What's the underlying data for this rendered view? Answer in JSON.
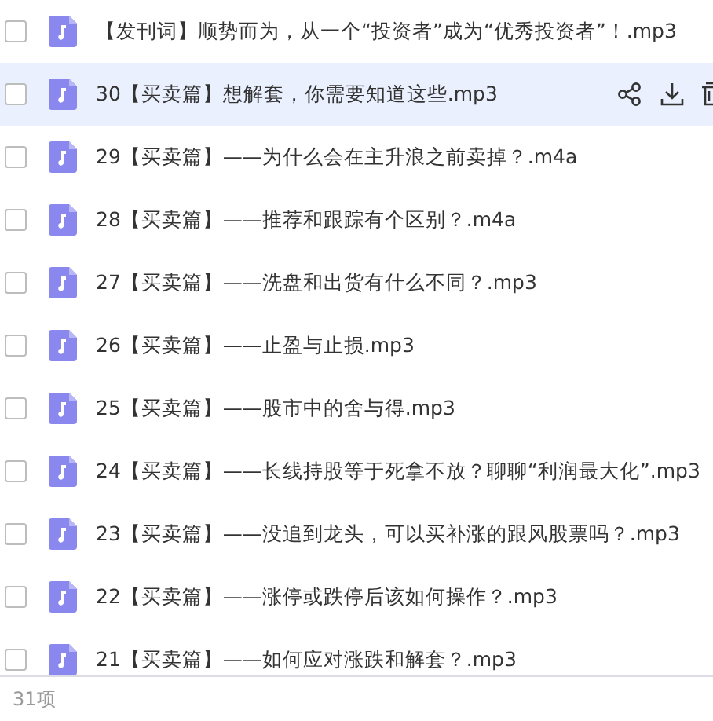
{
  "files": [
    {
      "name": "【发刊词】顺势而为，从一个“投资者”成为“优秀投资者”！.mp3",
      "checked": false,
      "highlighted": false
    },
    {
      "name": "30【买卖篇】想解套，你需要知道这些.mp3",
      "checked": false,
      "highlighted": true
    },
    {
      "name": "29【买卖篇】——为什么会在主升浪之前卖掉？.m4a",
      "checked": false,
      "highlighted": false
    },
    {
      "name": "28【买卖篇】——推荐和跟踪有个区别？.m4a",
      "checked": false,
      "highlighted": false
    },
    {
      "name": "27【买卖篇】——洗盘和出货有什么不同？.mp3",
      "checked": false,
      "highlighted": false
    },
    {
      "name": "26【买卖篇】——止盈与止损.mp3",
      "checked": false,
      "highlighted": false
    },
    {
      "name": "25【买卖篇】——股市中的舍与得.mp3",
      "checked": false,
      "highlighted": false
    },
    {
      "name": "24【买卖篇】——长线持股等于死拿不放？聊聊“利润最大化”.mp3",
      "checked": false,
      "highlighted": false
    },
    {
      "name": "23【买卖篇】——没追到龙头，可以买补涨的跟风股票吗？.mp3",
      "checked": false,
      "highlighted": false
    },
    {
      "name": "22【买卖篇】——涨停或跌停后该如何操作？.mp3",
      "checked": false,
      "highlighted": false
    },
    {
      "name": "21【买卖篇】——如何应对涨跌和解套？.mp3",
      "checked": false,
      "highlighted": false
    }
  ],
  "status_bar": {
    "count": "31项"
  }
}
